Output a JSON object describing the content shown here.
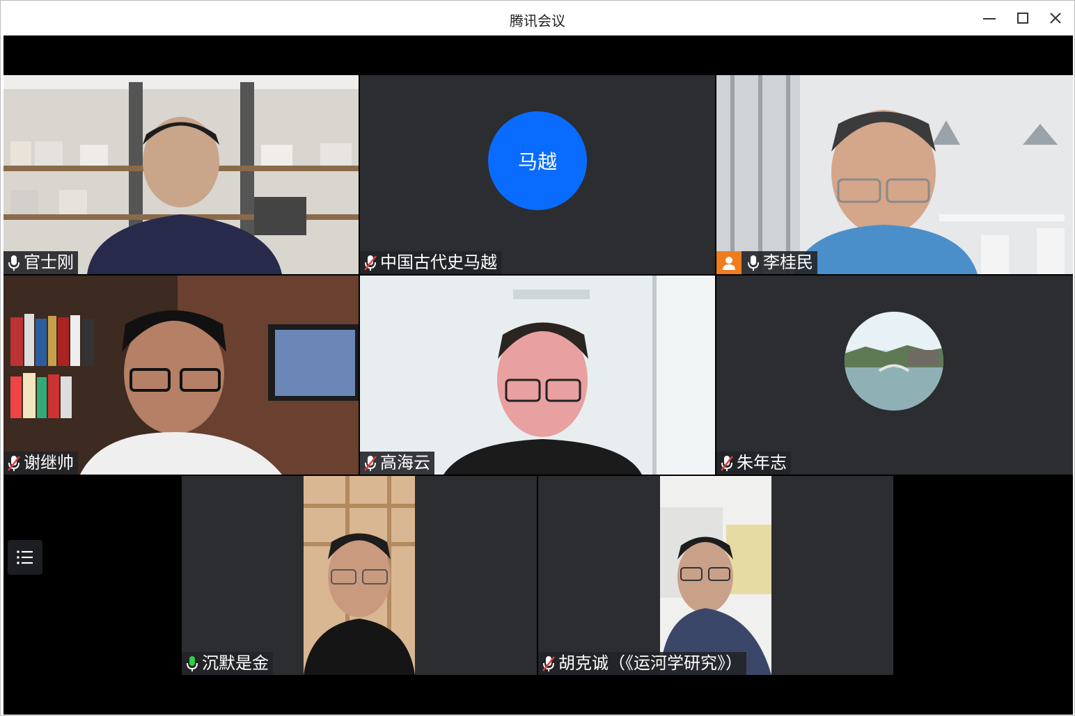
{
  "app": {
    "title": "腾讯会议"
  },
  "window_controls": [
    "minimize-icon",
    "maximize-icon",
    "close-icon"
  ],
  "participants": [
    {
      "name": "官士刚",
      "mic": "on",
      "video": true
    },
    {
      "name": "中国古代史马越",
      "mic": "muted",
      "video": false,
      "avatar_text": "马越",
      "avatar_color": "#0a6cff"
    },
    {
      "name": "李桂民",
      "mic": "on",
      "video": true,
      "host": true
    },
    {
      "name": "谢继帅",
      "mic": "muted",
      "video": true
    },
    {
      "name": "高海云",
      "mic": "muted",
      "video": true
    },
    {
      "name": "朱年志",
      "mic": "muted",
      "video": false,
      "avatar": "landscape-photo"
    },
    {
      "name": "沉默是金",
      "mic": "speaking",
      "video": true
    },
    {
      "name": "胡克诚（《运河学研究》）",
      "mic": "muted",
      "video": true
    }
  ],
  "colors": {
    "speaking_mic": "#2fcf4a",
    "host_badge": "#f07c1e",
    "avatar_blue": "#0a6cff"
  }
}
